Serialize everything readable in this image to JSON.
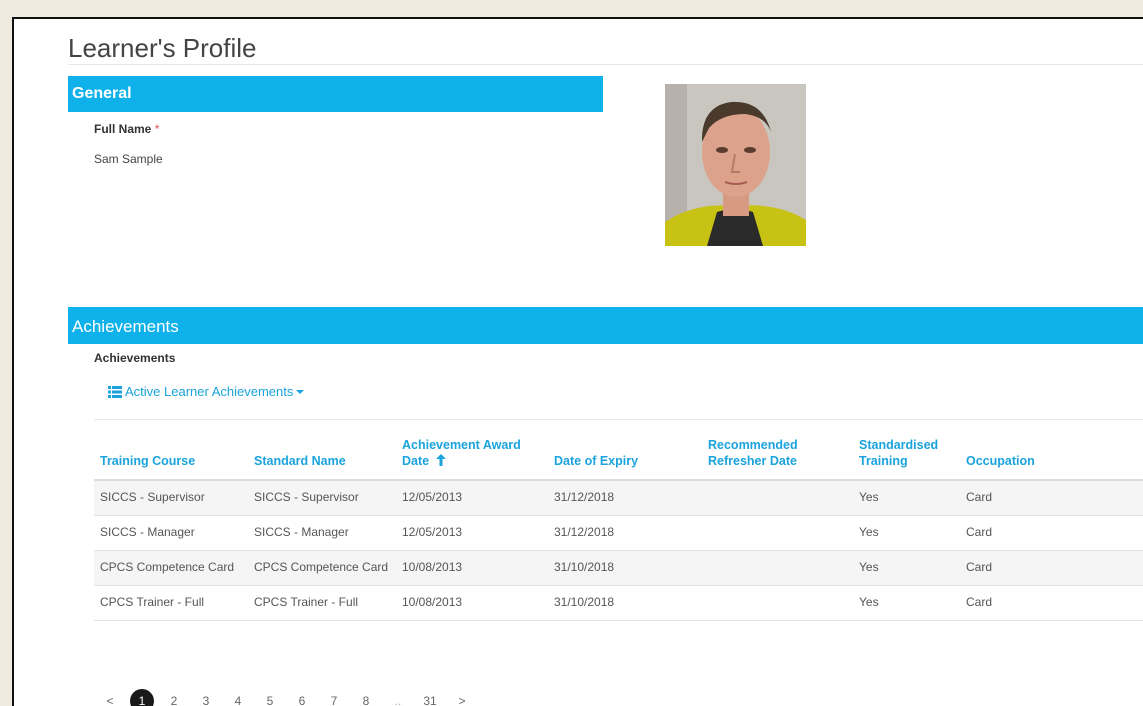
{
  "page": {
    "title": "Learner's Profile"
  },
  "general": {
    "heading": "General",
    "full_name_label": "Full Name",
    "required_mark": "*",
    "full_name_value": "Sam Sample"
  },
  "achievements": {
    "heading": "Achievements",
    "subheading": "Achievements",
    "dropdown_label": "Active Learner Achievements",
    "columns": [
      "Training Course",
      "Standard Name",
      "Achievement Award Date",
      "Date of Expiry",
      "Recommended Refresher Date",
      "Standardised Training",
      "Occupation"
    ],
    "rows": [
      [
        "SICCS - Supervisor",
        "SICCS - Supervisor",
        "12/05/2013",
        "31/12/2018",
        "",
        "Yes",
        "Card"
      ],
      [
        "SICCS - Manager",
        "SICCS - Manager",
        "12/05/2013",
        "31/12/2018",
        "",
        "Yes",
        "Card"
      ],
      [
        "CPCS Competence Card",
        "CPCS Competence Card",
        "10/08/2013",
        "31/10/2018",
        "",
        "Yes",
        "Card"
      ],
      [
        "CPCS Trainer - Full",
        "CPCS Trainer - Full",
        "10/08/2013",
        "31/10/2018",
        "",
        "Yes",
        "Card"
      ]
    ]
  },
  "pagination": {
    "prev": "<",
    "next": ">",
    "pages": [
      "1",
      "2",
      "3",
      "4",
      "5",
      "6",
      "7",
      "8",
      "..",
      "31"
    ],
    "active": "1"
  },
  "colors": {
    "accent": "#0fb1ea",
    "link": "#1aa3dc",
    "active_page": "#1a1a1a"
  }
}
